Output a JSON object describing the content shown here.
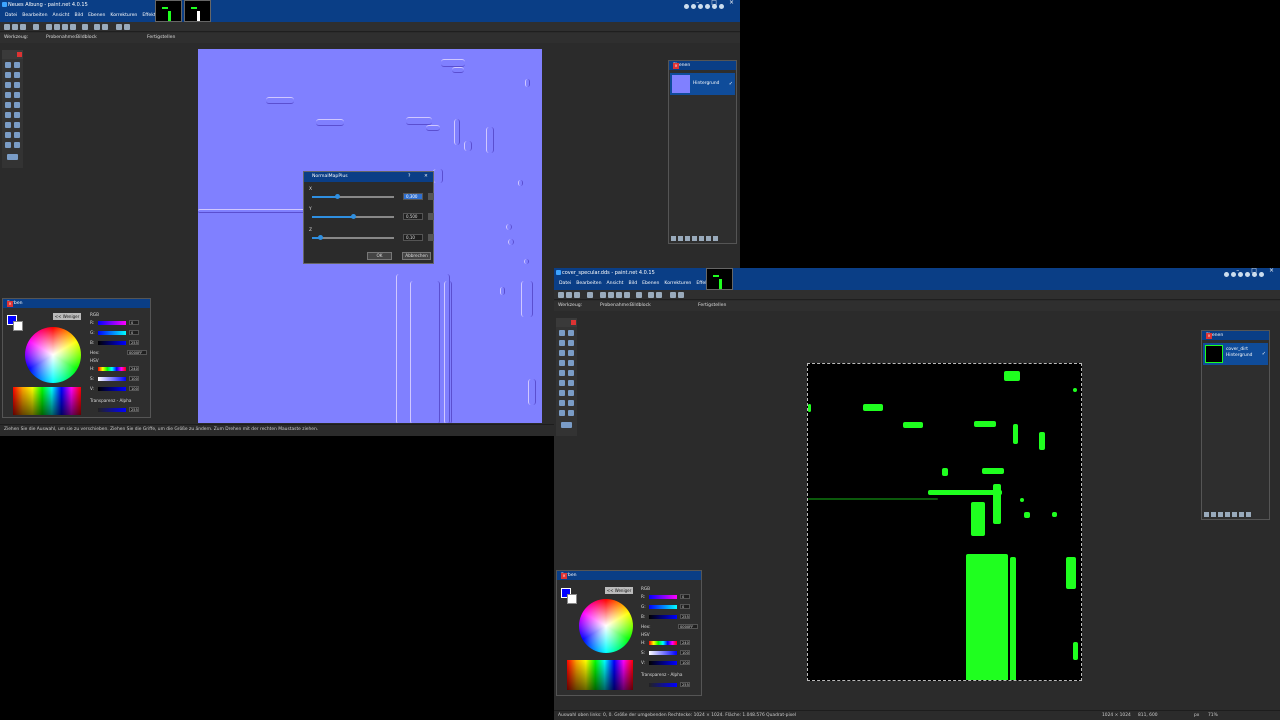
{
  "window1": {
    "title": "Neues Albung - paint.net 4.0.15",
    "menu": [
      "Datei",
      "Bearbeiten",
      "Ansicht",
      "Bild",
      "Ebenen",
      "Korrekturen",
      "Effekte"
    ],
    "toolbar2": {
      "tool_label": "Werkzeug:",
      "sampling_label": "Probenahme:",
      "sampling_value": "Bildblock",
      "finish_label": "Fertigstellen"
    },
    "status": "Ziehen Sie die Auswahl, um sie zu verschieben. Ziehen Sie die Griffe, um die Größe zu ändern. Zum Drehen mit der rechten Maustaste ziehen.",
    "layers_panel": {
      "title": "Ebenen",
      "layer": "Hintergrund"
    },
    "colors_panel": {
      "title": "Farben",
      "less": "<< Weniger",
      "rgb": "RGB",
      "r": "R:",
      "g": "G:",
      "b": "B:",
      "r_val": "0",
      "g_val": "0",
      "b_val": "255",
      "hex_label": "Hex:",
      "hex_val": "0000FF",
      "hsv": "HSV",
      "h": "H:",
      "s": "S:",
      "v": "V:",
      "h_val": "240",
      "s_val": "100",
      "v_val": "100",
      "alpha": "Transparenz - Alpha",
      "alpha_val": "255"
    }
  },
  "dialog": {
    "title": "NormalMapPlus",
    "help": "?",
    "close": "✕",
    "x_label": "X",
    "y_label": "Y",
    "z_label": "Z",
    "x_val": "0,300",
    "y_val": "0,500",
    "z_val": "0,10",
    "x_level": 0.3,
    "y_level": 0.5,
    "z_level": 0.1,
    "ok": "OK",
    "cancel": "Abbrechen"
  },
  "window2": {
    "title": "cover_specular.dds - paint.net 4.0.15",
    "menu": [
      "Datei",
      "Bearbeiten",
      "Ansicht",
      "Bild",
      "Ebenen",
      "Korrekturen",
      "Effekte"
    ],
    "toolbar2": {
      "tool_label": "Werkzeug:",
      "sampling_label": "Probenahme:",
      "sampling_value": "Bildblock",
      "finish_label": "Fertigstellen"
    },
    "status": "Auswahl oben links: 0, 0. Größe der umgebenden Rechtecke: 1024 × 1024. Fläche: 1.048.576 Quadrat-pixel",
    "status_size": "1024 × 1024",
    "status_pos": "811, 600",
    "status_unit": "px",
    "status_zoom": "71%",
    "layers_panel": {
      "title": "Ebenen",
      "layer_line1": "cover_dirt",
      "layer_line2": "Hintergrund"
    },
    "colors_panel": {
      "title": "Farben",
      "less": "<< Weniger",
      "rgb": "RGB",
      "r": "R:",
      "g": "G:",
      "b": "B:",
      "r_val": "0",
      "g_val": "0",
      "b_val": "255",
      "hex_label": "Hex:",
      "hex_val": "0000FF",
      "hsv": "HSV",
      "h": "H:",
      "s": "S:",
      "v": "V:",
      "h_val": "240",
      "s_val": "100",
      "v_val": "100",
      "alpha": "Transparenz - Alpha",
      "alpha_val": "255"
    }
  },
  "colors": {
    "accent": "#0a3e86",
    "primary_color": "#0000ff",
    "secondary_color": "#ffffff",
    "normal_map_bg": "#8080ff",
    "specular_green": "#1fff1f"
  }
}
